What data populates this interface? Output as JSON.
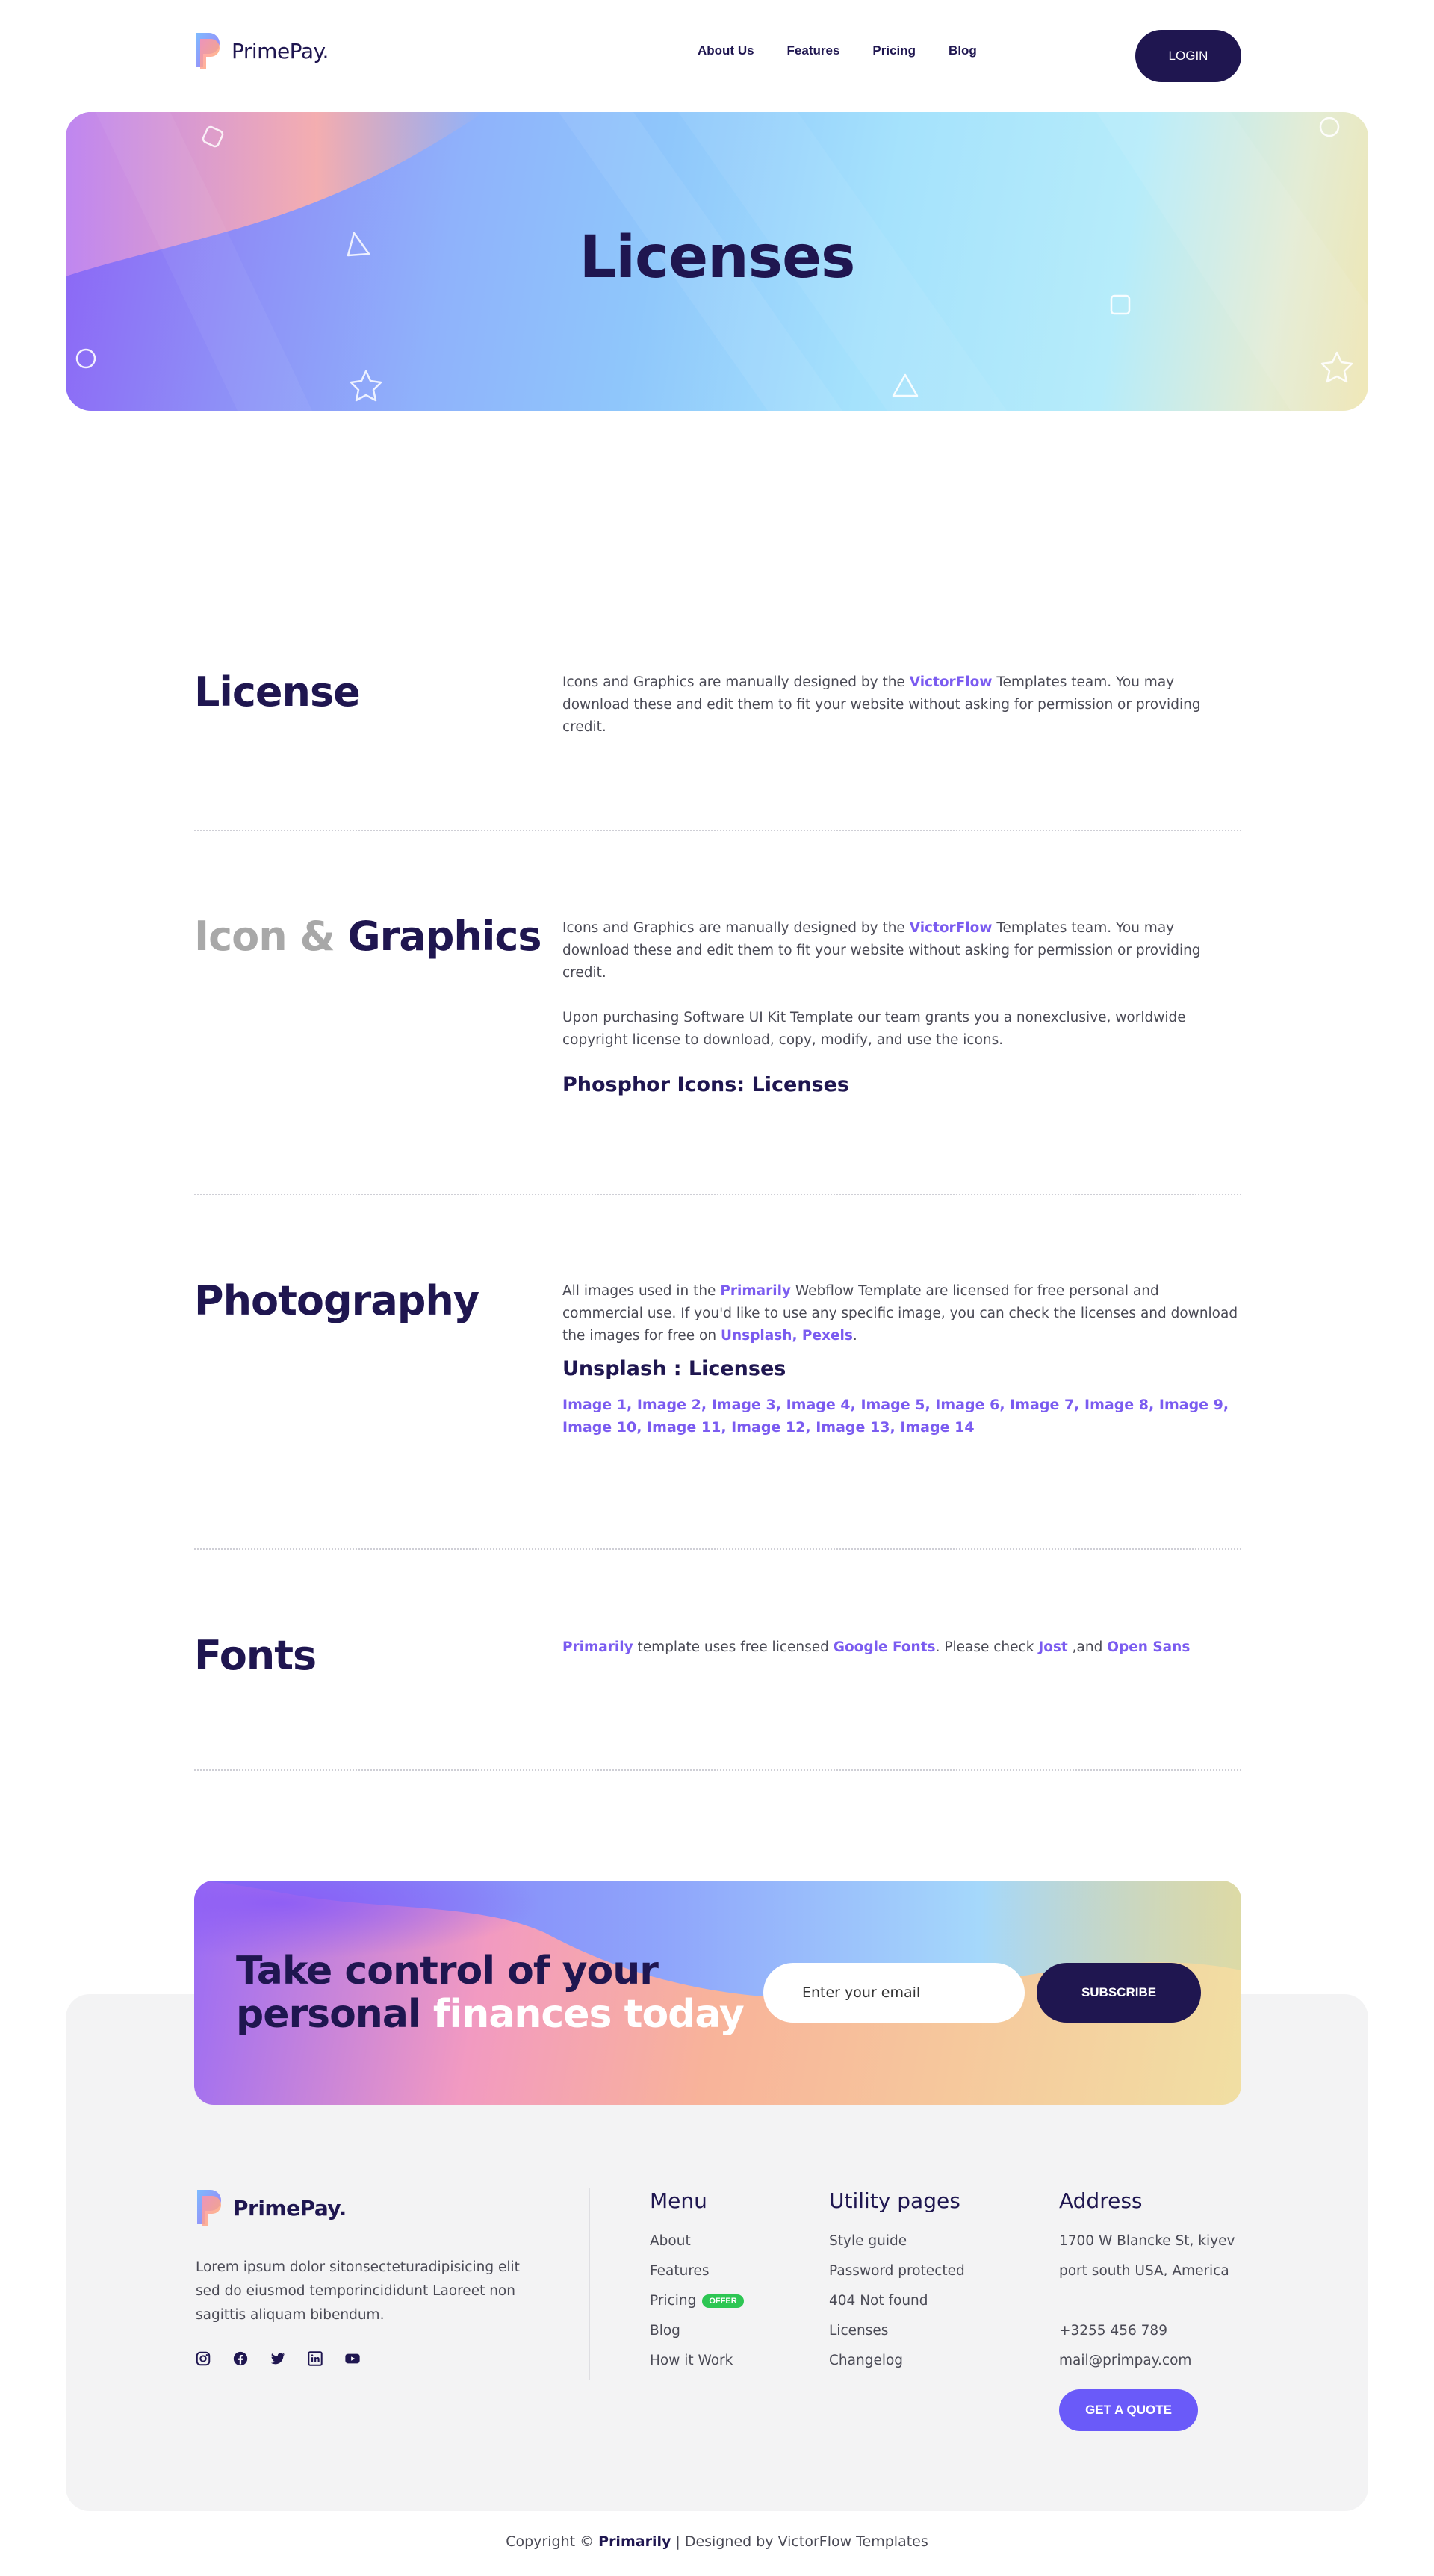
{
  "brand": {
    "name": "PrimePay.",
    "colors": {
      "navy": "#1f1650",
      "purple": "#7b5cf0",
      "offer": "#2dc653",
      "quote": "#6a5af9"
    }
  },
  "nav": {
    "links": [
      "About Us",
      "Features",
      "Pricing",
      "Blog"
    ],
    "login_label": "LOGIN"
  },
  "hero": {
    "title": "Licenses"
  },
  "sections": {
    "license": {
      "title": "License",
      "body": {
        "pre": "Icons and Graphics are manually designed by the ",
        "link": "VictorFlow",
        "post": " Templates team. You may download these and edit them to fit your website without asking for permission or providing credit."
      }
    },
    "icons": {
      "title_muted": "Icon &",
      "title_main": "Graphics",
      "body1": {
        "pre": "Icons and Graphics are manually designed by the ",
        "link": "VictorFlow",
        "post": " Templates team. You may download these and edit them to fit your website without asking for permission or providing credit."
      },
      "body2": "Upon purchasing Software UI Kit Template our team grants you a nonexclusive, worldwide copyright license to download, copy, modify, and use the icons.",
      "subhead": "Phosphor Icons: Licenses"
    },
    "photography": {
      "title": "Photography",
      "body": {
        "pre": "All images used in the ",
        "link": "Primarily",
        "mid": " Webflow Template are licensed for free personal and commercial use. If you'd like to use any specific image, you can check the licenses and download the images for free on ",
        "link2": "Unsplash, Pexels",
        "post": "."
      },
      "subhead": "Unsplash : Licenses",
      "images": [
        "Image 1",
        "Image 2",
        "Image 3",
        "Image 4",
        "Image 5",
        "Image 6",
        "Image 7",
        "Image 8",
        "Image 9",
        "Image 10",
        "Image 11",
        "Image 12",
        "Image 13",
        "Image 14"
      ]
    },
    "fonts": {
      "title": "Fonts",
      "link1": "Primarily",
      "mid1": " template uses free licensed ",
      "link2": "Google Fonts",
      "mid2": ". Please check ",
      "link3": "Jost",
      "mid3": " ,and ",
      "link4": "Open Sans"
    }
  },
  "cta": {
    "title_dark_1": "Take control of your",
    "title_dark_2": "personal ",
    "title_light": "finances today",
    "email_placeholder": "Enter your email",
    "subscribe_label": "SUBSCRIBE"
  },
  "footer": {
    "description": "Lorem ipsum dolor sitonsecteturadipisicing elit sed do eiusmod temporincididunt Laoreet non sagittis aliquam bibendum.",
    "socials": [
      "instagram-icon",
      "facebook-icon",
      "twitter-icon",
      "linkedin-icon",
      "youtube-icon"
    ],
    "menu": {
      "title": "Menu",
      "items": [
        "About",
        "Features",
        "Pricing",
        "Blog",
        "How it Work"
      ],
      "offer_badge": "OFFER"
    },
    "utility": {
      "title": "Utility pages",
      "items": [
        "Style guide",
        "Password protected",
        "404 Not found",
        "Licenses",
        "Changelog"
      ]
    },
    "address": {
      "title": "Address",
      "line1": "1700 W Blancke St, kiyev",
      "line2": "port south USA, America",
      "phone": "+3255 456 789",
      "email": "mail@primpay.com",
      "quote_label": "GET A QUOTE"
    },
    "copyright": {
      "pre": "Copyright © ",
      "brand": "Primarily",
      "post": " | Designed by VictorFlow Templates"
    }
  }
}
